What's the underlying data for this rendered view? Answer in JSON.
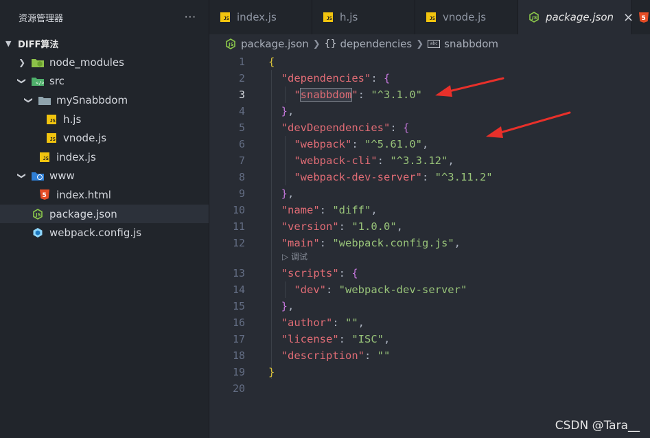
{
  "sidebar": {
    "title": "资源管理器",
    "more": "···",
    "project": "DIFF算法",
    "items": [
      {
        "label": "node_modules",
        "icon": "node-folder-icon"
      },
      {
        "label": "src",
        "icon": "src-folder-icon"
      },
      {
        "label": "mySnabbdom",
        "icon": "folder-icon"
      },
      {
        "label": "h.js",
        "icon": "js-file-icon"
      },
      {
        "label": "vnode.js",
        "icon": "js-file-icon"
      },
      {
        "label": "index.js",
        "icon": "js-file-icon"
      },
      {
        "label": "www",
        "icon": "www-folder-icon"
      },
      {
        "label": "index.html",
        "icon": "html5-file-icon"
      },
      {
        "label": "package.json",
        "icon": "nodejs-file-icon"
      },
      {
        "label": "webpack.config.js",
        "icon": "webpack-file-icon"
      }
    ],
    "js_badge": "JS"
  },
  "tabs": [
    {
      "label": "index.js"
    },
    {
      "label": "h.js"
    },
    {
      "label": "vnode.js"
    },
    {
      "label": "package.json",
      "active": true,
      "close": "×"
    }
  ],
  "breadcrumb": {
    "file": "package.json",
    "object_icon": "{}",
    "object": "dependencies",
    "string_icon": "abc",
    "key": "snabbdom"
  },
  "editor": {
    "line_numbers": [
      "1",
      "2",
      "3",
      "4",
      "5",
      "6",
      "7",
      "8",
      "9",
      "10",
      "11",
      "12",
      "13",
      "14",
      "15",
      "16",
      "17",
      "18",
      "19",
      "20"
    ],
    "codelens": "▷ 调试",
    "tokens": {
      "dependencies": "\"dependencies\"",
      "snabbdom": "snabbdom",
      "snabbdom_ver": "\"^3.1.0\"",
      "devDependencies": "\"devDependencies\"",
      "webpack": "\"webpack\"",
      "webpack_ver": "\"^5.61.0\"",
      "webpack_cli": "\"webpack-cli\"",
      "webpack_cli_ver": "\"^3.3.12\"",
      "webpack_dev_server": "\"webpack-dev-server\"",
      "webpack_dev_server_ver": "\"^3.11.2\"",
      "name": "\"name\"",
      "name_val": "\"diff\"",
      "version": "\"version\"",
      "version_val": "\"1.0.0\"",
      "main": "\"main\"",
      "main_val": "\"webpack.config.js\"",
      "scripts": "\"scripts\"",
      "dev": "\"dev\"",
      "dev_val": "\"webpack-dev-server\"",
      "author": "\"author\"",
      "author_val": "\"\"",
      "license": "\"license\"",
      "license_val": "\"ISC\"",
      "description": "\"description\"",
      "description_val": "\"\""
    }
  },
  "watermark": "CSDN @Tara__",
  "colors": {
    "key": "#e06c75",
    "string": "#98c379",
    "brace_outer": "#d8c13a",
    "brace_inner": "#c678dd",
    "annotation_arrow": "#e8302a"
  }
}
